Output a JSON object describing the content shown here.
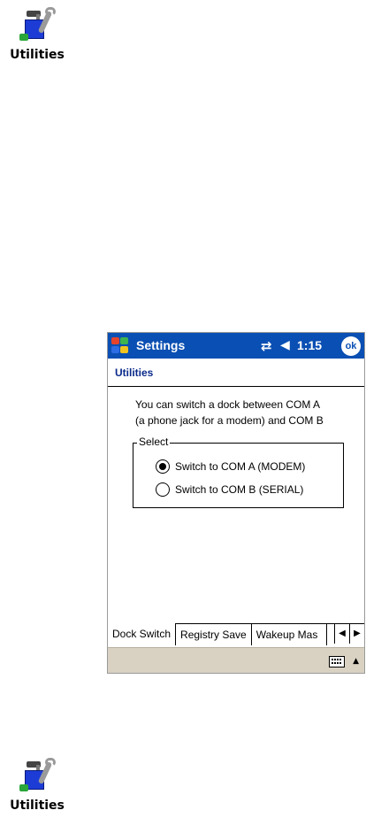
{
  "app_icon": {
    "label": "Utilities"
  },
  "titlebar": {
    "title": "Settings",
    "connectivity_symbol": "⇄",
    "volume_symbol": "◀",
    "time": "1:15",
    "ok_label": "ok"
  },
  "page": {
    "header": "Utilities",
    "description_line1": "You can switch a dock between COM A",
    "description_line2": "(a phone jack for a modem) and COM B"
  },
  "select_group": {
    "label": "Select",
    "options": [
      {
        "label": "Switch to COM A (MODEM)",
        "selected": true
      },
      {
        "label": "Switch to COM B (SERIAL)",
        "selected": false
      }
    ]
  },
  "tabs": [
    {
      "label": "Dock Switch",
      "active": true
    },
    {
      "label": "Registry Save",
      "active": false
    },
    {
      "label": "Wakeup Mas",
      "active": false
    }
  ],
  "tab_scroll": {
    "left": "◀",
    "right": "▶"
  },
  "menubar": {
    "sip_arrow": "▲"
  },
  "colors": {
    "titlebar": "#0a4fb3",
    "header_text": "#0a2a8a",
    "menubar": "#d9d2c3"
  }
}
